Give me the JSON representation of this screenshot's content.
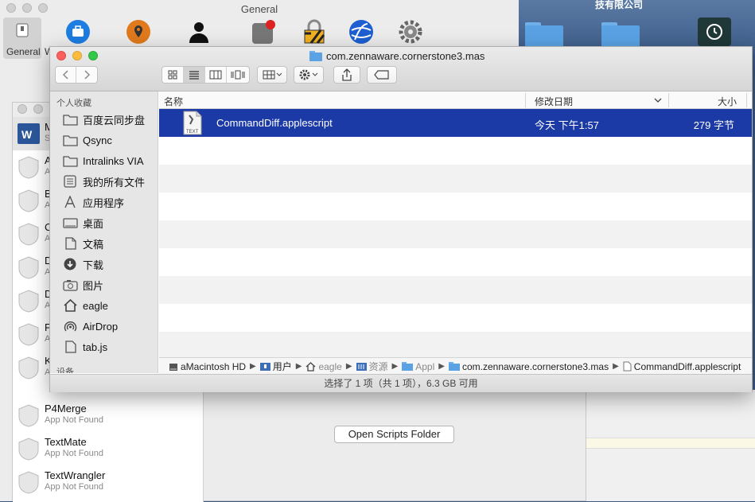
{
  "desktop": {
    "title": "技有限公司"
  },
  "general_window": {
    "title": "General",
    "toolbar_label": "General",
    "toolbar_label_partial": "W"
  },
  "apps_window": {
    "button_label": "Open Scripts Folder",
    "partial_letters": [
      "M",
      "A",
      "B",
      "C",
      "D",
      "D",
      "F",
      "K"
    ],
    "partial_sub": [
      "S",
      "A",
      "A",
      "A",
      "A",
      "A",
      "A",
      "A"
    ],
    "apps": [
      {
        "name": "P4Merge",
        "status": "App Not Found"
      },
      {
        "name": "TextMate",
        "status": "App Not Found"
      },
      {
        "name": "TextWrangler",
        "status": "App Not Found"
      }
    ]
  },
  "finder": {
    "title": "com.zennaware.cornerstone3.mas",
    "sidebar": {
      "favorites_header": "个人收藏",
      "devices_header": "设备",
      "items": [
        {
          "label": "百度云同步盘",
          "icon": "folder-icon"
        },
        {
          "label": "Qsync",
          "icon": "folder-icon"
        },
        {
          "label": "Intralinks VIA",
          "icon": "folder-icon"
        },
        {
          "label": "我的所有文件",
          "icon": "all-files-icon"
        },
        {
          "label": "应用程序",
          "icon": "applications-icon"
        },
        {
          "label": "桌面",
          "icon": "desktop-icon"
        },
        {
          "label": "文稿",
          "icon": "documents-icon"
        },
        {
          "label": "下载",
          "icon": "downloads-icon"
        },
        {
          "label": "图片",
          "icon": "pictures-icon"
        },
        {
          "label": "eagle",
          "icon": "home-icon"
        },
        {
          "label": "AirDrop",
          "icon": "airdrop-icon"
        },
        {
          "label": "tab.js",
          "icon": "document-icon"
        }
      ]
    },
    "columns": {
      "name": "名称",
      "date": "修改日期",
      "size": "大小"
    },
    "files": [
      {
        "name": "CommandDiff.applescript",
        "date": "今天 下午1:57",
        "size": "279 字节",
        "icon_text": "TEXT"
      }
    ],
    "path": [
      {
        "label": "aMacintosh HD"
      },
      {
        "label": "用户"
      },
      {
        "label": "eagle"
      },
      {
        "label": "资源"
      },
      {
        "label": "Appl"
      },
      {
        "label": "com.zennaware.cornerstone3.mas"
      },
      {
        "label": "CommandDiff.applescript"
      }
    ],
    "status": "选择了 1 项（共 1 项），6.3 GB 可用"
  },
  "colors": {
    "selection": "#1c3aa6",
    "close": "#fc605c",
    "minimize": "#fdbc40",
    "zoom": "#34c84a"
  }
}
